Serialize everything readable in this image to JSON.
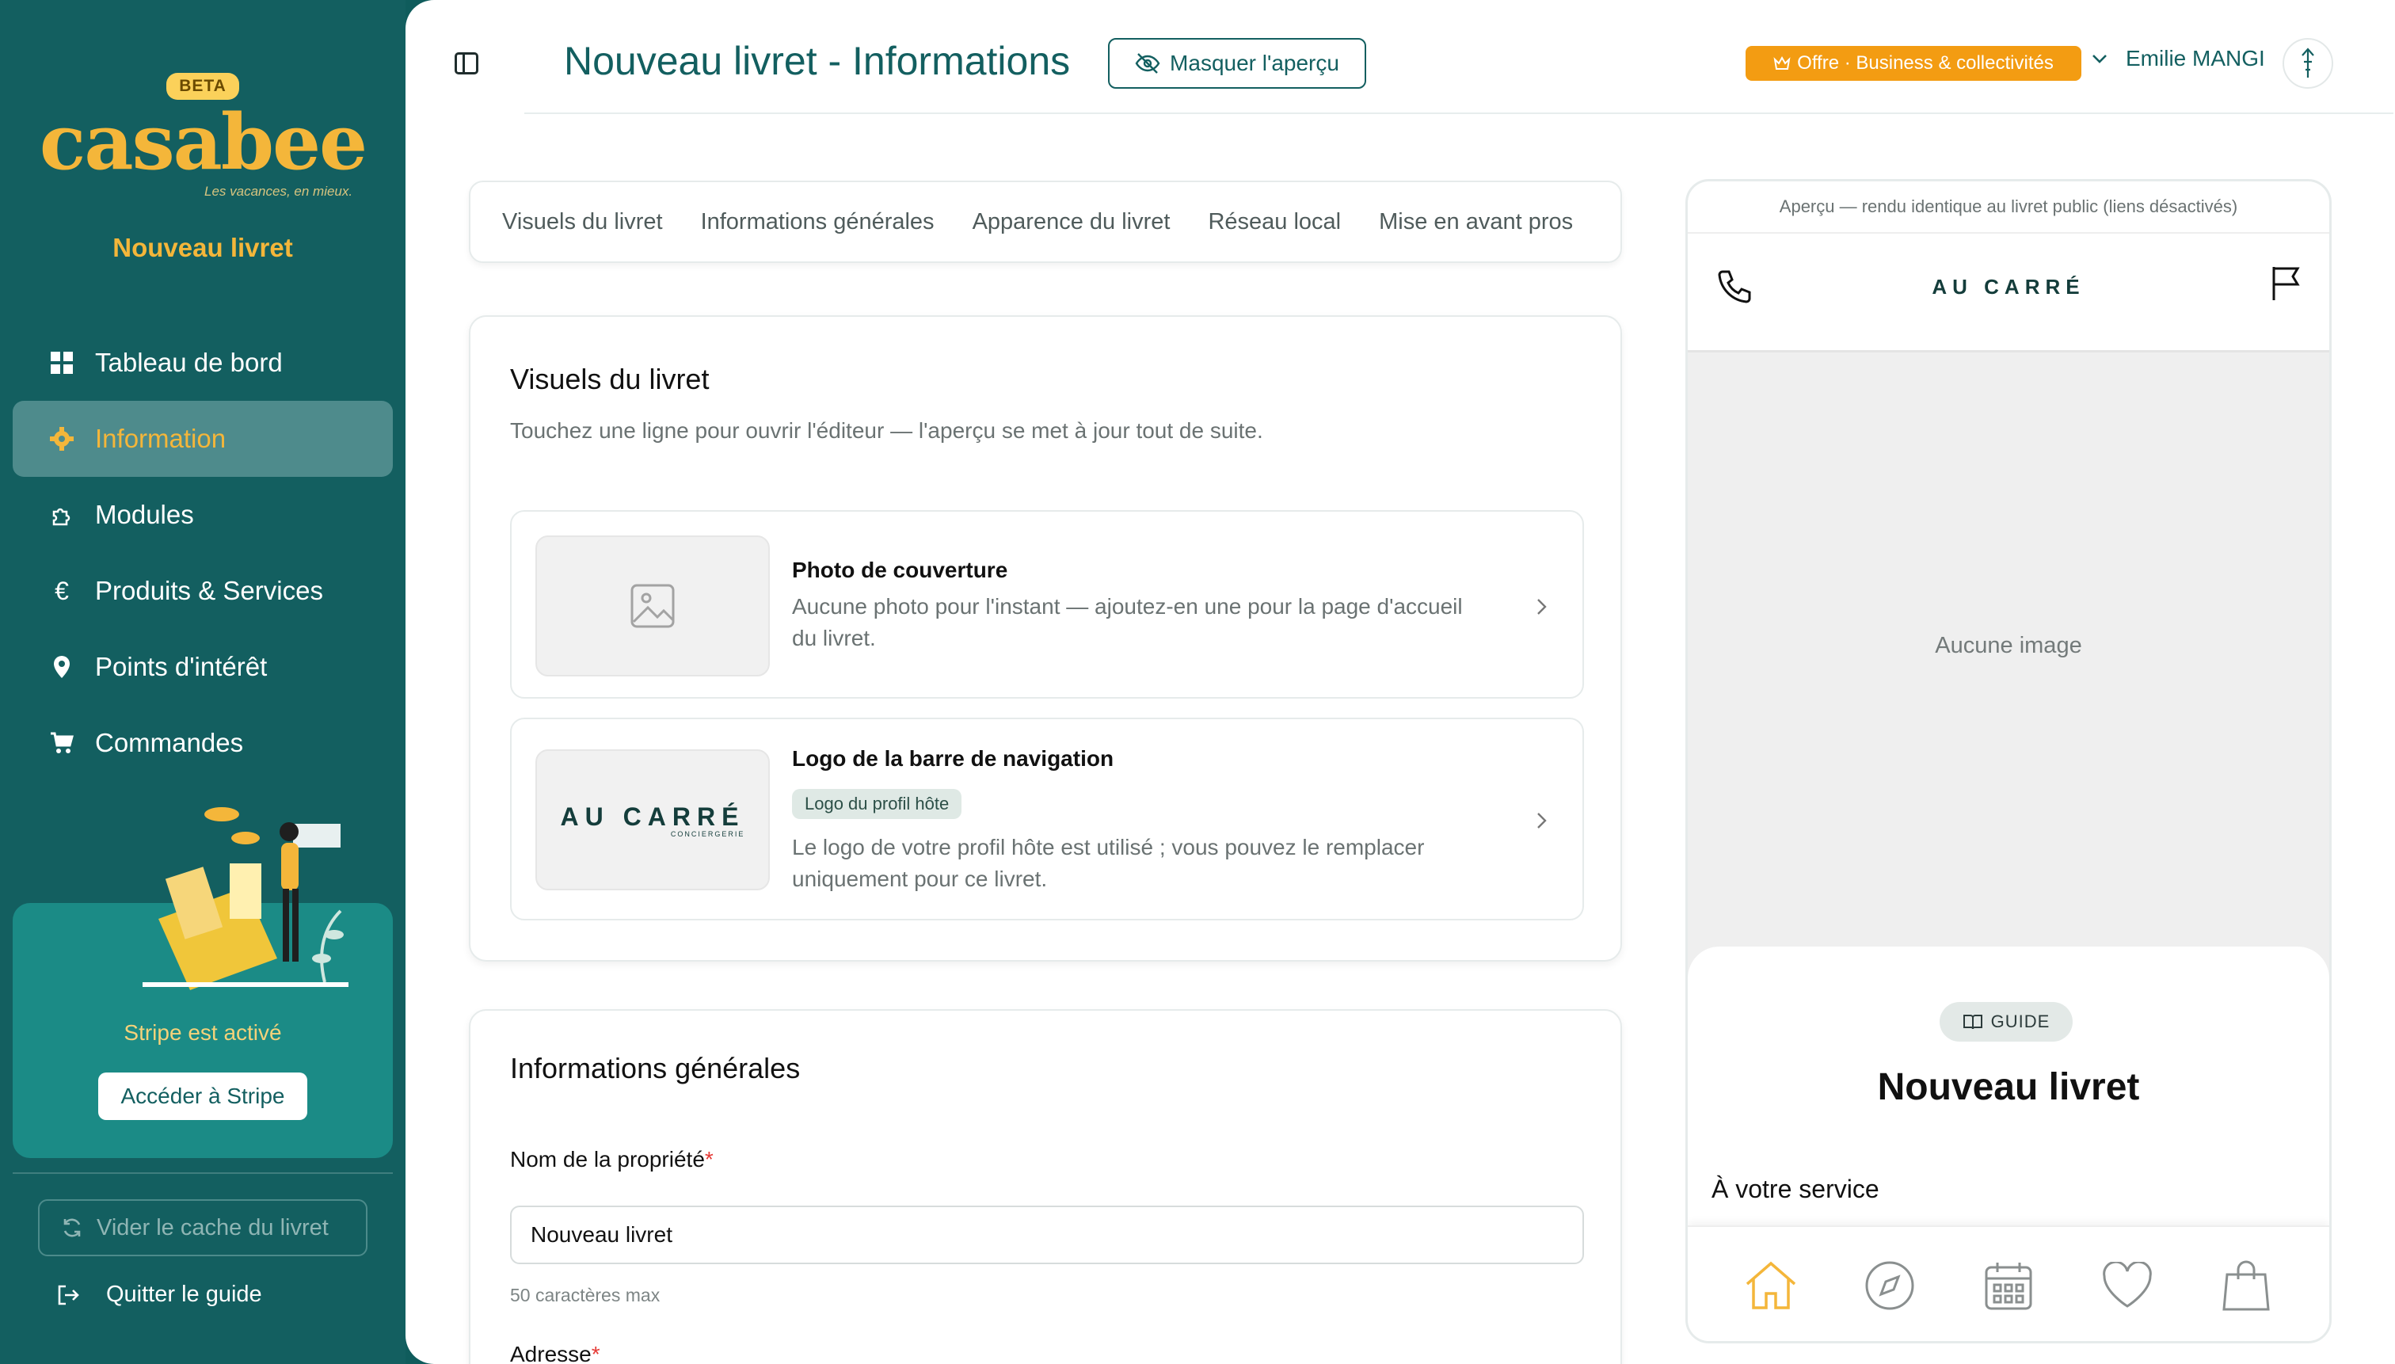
{
  "sidebar": {
    "beta": "BETA",
    "logo_text": "casabee",
    "logo_tagline": "Les vacances, en mieux.",
    "title": "Nouveau livret",
    "items": [
      {
        "label": "Tableau de bord",
        "icon": "dashboard-icon"
      },
      {
        "label": "Information",
        "icon": "gear-icon",
        "active": true
      },
      {
        "label": "Modules",
        "icon": "puzzle-icon"
      },
      {
        "label": "Produits & Services",
        "icon": "euro-icon"
      },
      {
        "label": "Points d'intérêt",
        "icon": "map-pin-icon"
      },
      {
        "label": "Commandes",
        "icon": "cart-icon"
      }
    ],
    "stripe_status": "Stripe est activé",
    "stripe_button": "Accéder à Stripe",
    "cache_button": "Vider le cache du livret",
    "quit_label": "Quitter le guide"
  },
  "header": {
    "title": "Nouveau livret - Informations",
    "preview_toggle": "Masquer l'aperçu",
    "offer_badge": "Offre · Business & collectivités",
    "user_name": "Emilie MANGI"
  },
  "tabs": [
    "Visuels du livret",
    "Informations générales",
    "Apparence du livret",
    "Réseau local",
    "Mise en avant pros"
  ],
  "visuels": {
    "title": "Visuels du livret",
    "subtitle": "Touchez une ligne pour ouvrir l'éditeur — l'aperçu se met à jour tout de suite.",
    "cover": {
      "title": "Photo de couverture",
      "desc": "Aucune photo pour l'instant — ajoutez-en une pour la page d'accueil du livret."
    },
    "logo": {
      "title": "Logo de la barre de navigation",
      "tag": "Logo du profil hôte",
      "desc": "Le logo de votre profil hôte est utilisé ; vous pouvez le remplacer uniquement pour ce livret.",
      "brand": "AU CARRÉ",
      "brand_sub": "CONCIERGERIE"
    }
  },
  "infos": {
    "title": "Informations générales",
    "name_label": "Nom de la propriété",
    "name_value": "Nouveau livret",
    "name_hint": "50 caractères max",
    "address_label": "Adresse"
  },
  "preview": {
    "caption": "Aperçu — rendu identique au livret public (liens désactivés)",
    "no_image": "Aucune image",
    "guide_badge": "GUIDE",
    "title": "Nouveau livret",
    "section": "À votre service",
    "brand": "AU CARRÉ"
  },
  "colors": {
    "sidebar_bg": "#135f60",
    "accent": "#f4b63a",
    "offer": "#f39c12"
  }
}
